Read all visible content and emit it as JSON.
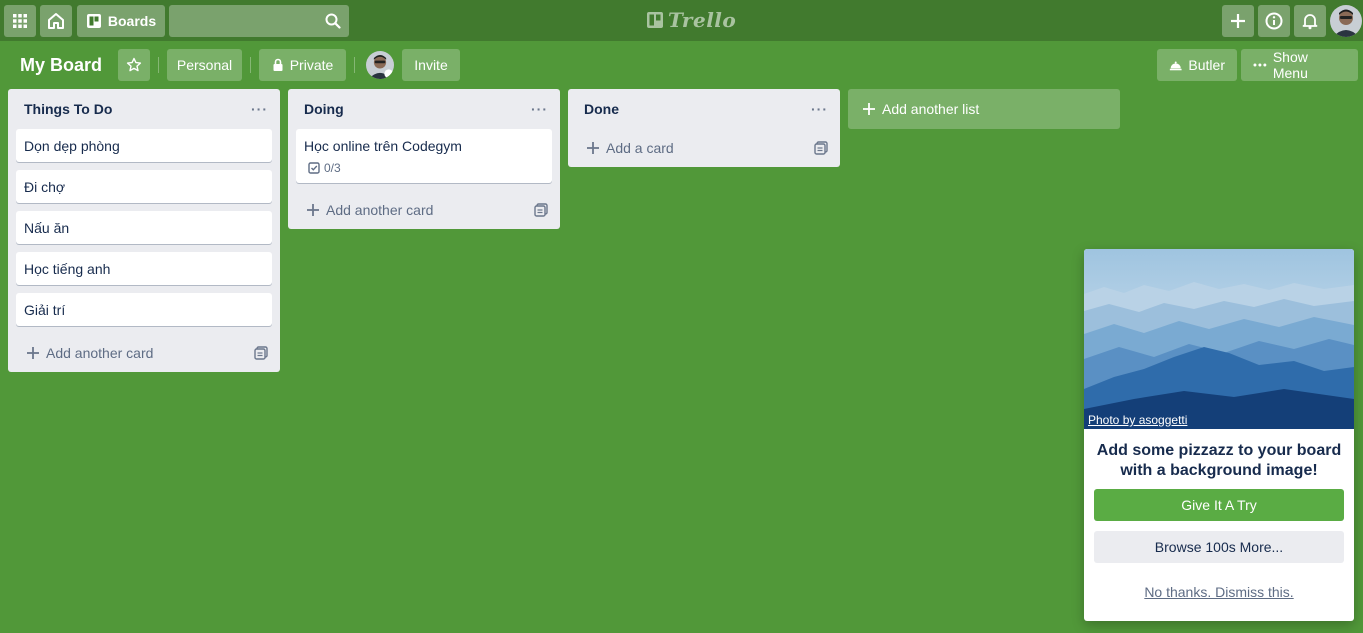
{
  "header": {
    "apps_icon": "grid-icon",
    "home_icon": "home-icon",
    "boards_label": "Boards",
    "search_value": "",
    "logo_text": "Trello",
    "right_icons": [
      "plus-icon",
      "info-icon",
      "bell-icon"
    ]
  },
  "board": {
    "title": "My Board",
    "personal_label": "Personal",
    "private_label": "Private",
    "invite_label": "Invite",
    "butler_label": "Butler",
    "show_menu_label": "Show Menu"
  },
  "lists": [
    {
      "title": "Things To Do",
      "cards": [
        "Dọn dẹp phòng",
        "Đi chợ",
        "Nấu ăn",
        "Học tiếng anh",
        "Giải trí"
      ],
      "add_label": "Add another card"
    },
    {
      "title": "Doing",
      "cards": [
        "Học online trên Codegym"
      ],
      "checklist": "0/3",
      "add_label": "Add another card"
    },
    {
      "title": "Done",
      "cards": [],
      "add_label": "Add a card"
    }
  ],
  "add_list_label": "Add another list",
  "promo": {
    "photo_credit": "Photo by asoggetti",
    "heading": "Add some pizzazz to your board with a background image!",
    "try_label": "Give It A Try",
    "browse_label": "Browse 100s More...",
    "dismiss_label": "No thanks. Dismiss this."
  },
  "colors": {
    "board_bg": "#519839",
    "header_bg": "#417a2e",
    "list_bg": "#ebecf0",
    "primary_button": "#5aac44"
  }
}
